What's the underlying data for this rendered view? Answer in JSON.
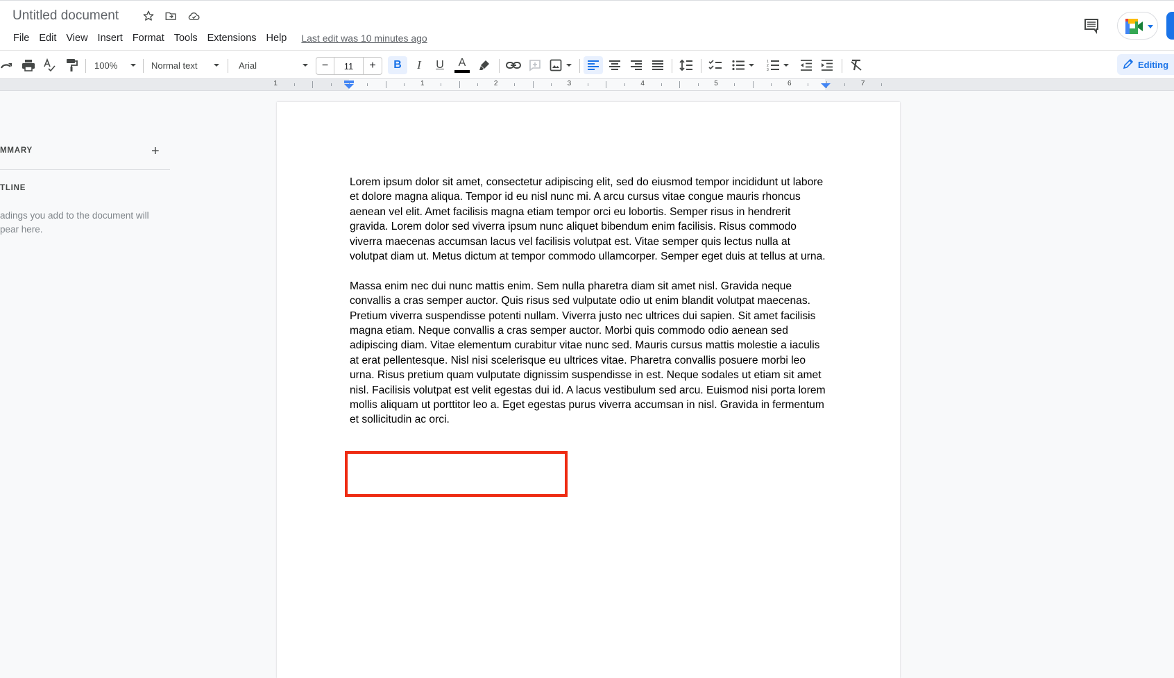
{
  "header": {
    "doc_title": "Untitled document",
    "menu": [
      "File",
      "Edit",
      "View",
      "Insert",
      "Format",
      "Tools",
      "Extensions",
      "Help"
    ],
    "last_edit": "Last edit was 10 minutes ago",
    "icons": [
      "star-icon",
      "move-to-folder-icon",
      "cloud-saved-icon",
      "comment-history-icon",
      "google-meet-icon"
    ]
  },
  "toolbar": {
    "zoom": "100%",
    "style": "Normal text",
    "font": "Arial",
    "font_size": "11",
    "decrease_label": "−",
    "increase_label": "+",
    "bold_label": "B",
    "italic_label": "I",
    "underline_label": "U",
    "text_color_label": "A",
    "text_color": "#000000",
    "active": [
      "bold",
      "align-left"
    ],
    "mode": "Editing"
  },
  "ruler": {
    "labels": [
      "1",
      "1",
      "2",
      "3",
      "4",
      "5",
      "6",
      "7"
    ]
  },
  "sidebar": {
    "summary_label": "MMARY",
    "summary_add": "+",
    "outline_label": "TLINE",
    "outline_hint": "adings you add to the document will pear here."
  },
  "document": {
    "paragraphs": [
      "Lorem ipsum dolor sit amet, consectetur adipiscing elit, sed do eiusmod tempor incididunt ut labore et dolore magna aliqua. Tempor id eu nisl nunc mi. A arcu cursus vitae congue mauris rhoncus aenean vel elit. Amet facilisis magna etiam tempor orci eu lobortis. Semper risus in hendrerit gravida. Lorem dolor sed viverra ipsum nunc aliquet bibendum enim facilisis. Risus commodo viverra maecenas accumsan lacus vel facilisis volutpat est. Vitae semper quis lectus nulla at volutpat diam ut. Metus dictum at tempor commodo ullamcorper. Semper eget duis at tellus at urna.",
      "Massa enim nec dui nunc mattis enim. Sem nulla pharetra diam sit amet nisl. Gravida neque convallis a cras semper auctor. Quis risus sed vulputate odio ut enim blandit volutpat maecenas. Pretium viverra suspendisse potenti nullam. Viverra justo nec ultrices dui sapien. Sit amet facilisis magna etiam. Neque convallis a cras semper auctor. Morbi quis commodo odio aenean sed adipiscing diam. Vitae elementum curabitur vitae nunc sed. Mauris cursus mattis molestie a iaculis at erat pellentesque. Nisl nisi scelerisque eu ultrices vitae. Pharetra convallis posuere morbi leo urna. Risus pretium quam vulputate dignissim suspendisse in est. Neque sodales ut etiam sit amet nisl. Facilisis volutpat est velit egestas dui id. A lacus vestibulum sed arcu. Euismod nisi porta lorem mollis aliquam ut porttitor leo a. Eget egestas purus viverra accumsan in nisl. Gravida in fermentum et sollicitudin ac orci."
    ],
    "highlight_color": "#ee2b12"
  }
}
